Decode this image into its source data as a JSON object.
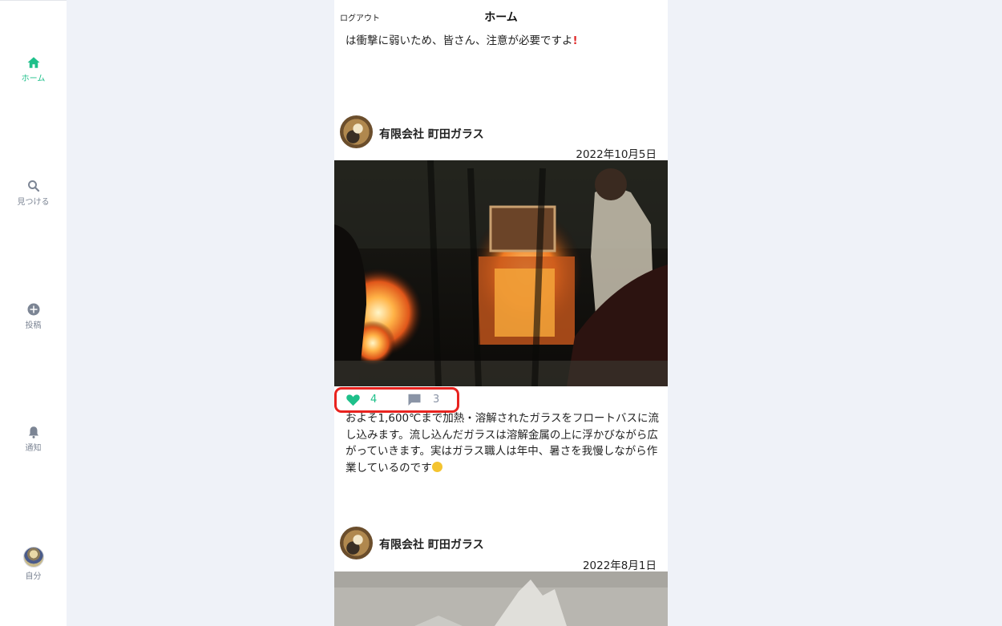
{
  "sidebar": {
    "items": [
      {
        "label": "ホーム",
        "icon": "home-icon",
        "active": true
      },
      {
        "label": "見つける",
        "icon": "search-icon",
        "active": false
      },
      {
        "label": "投稿",
        "icon": "plus-circle-icon",
        "active": false
      },
      {
        "label": "通知",
        "icon": "bell-icon",
        "active": false
      },
      {
        "label": "自分",
        "icon": "avatar",
        "active": false
      }
    ]
  },
  "header": {
    "logout_label": "ログアウト",
    "title": "ホーム"
  },
  "feed": {
    "prev_post_tail": "は衝撃に弱いため、皆さん、注意が必要ですよ",
    "posts": [
      {
        "author": "有限会社 町田ガラス",
        "date": "2022年10月5日",
        "likes": "4",
        "comments": "3",
        "text": "およそ1,600℃まで加熱・溶解されたガラスをフロートバスに流し込みます。流し込んだガラスは溶解金属の上に浮かびながら広がっていきます。実はガラス職人は年中、暑さを我慢しながら作業しているのです"
      },
      {
        "author": "有限会社 町田ガラス",
        "date": "2022年8月1日"
      }
    ]
  },
  "colors": {
    "accent": "#1ec08a",
    "highlight": "#e8231f",
    "muted": "#8a94a6",
    "background": "#eff2f8"
  }
}
